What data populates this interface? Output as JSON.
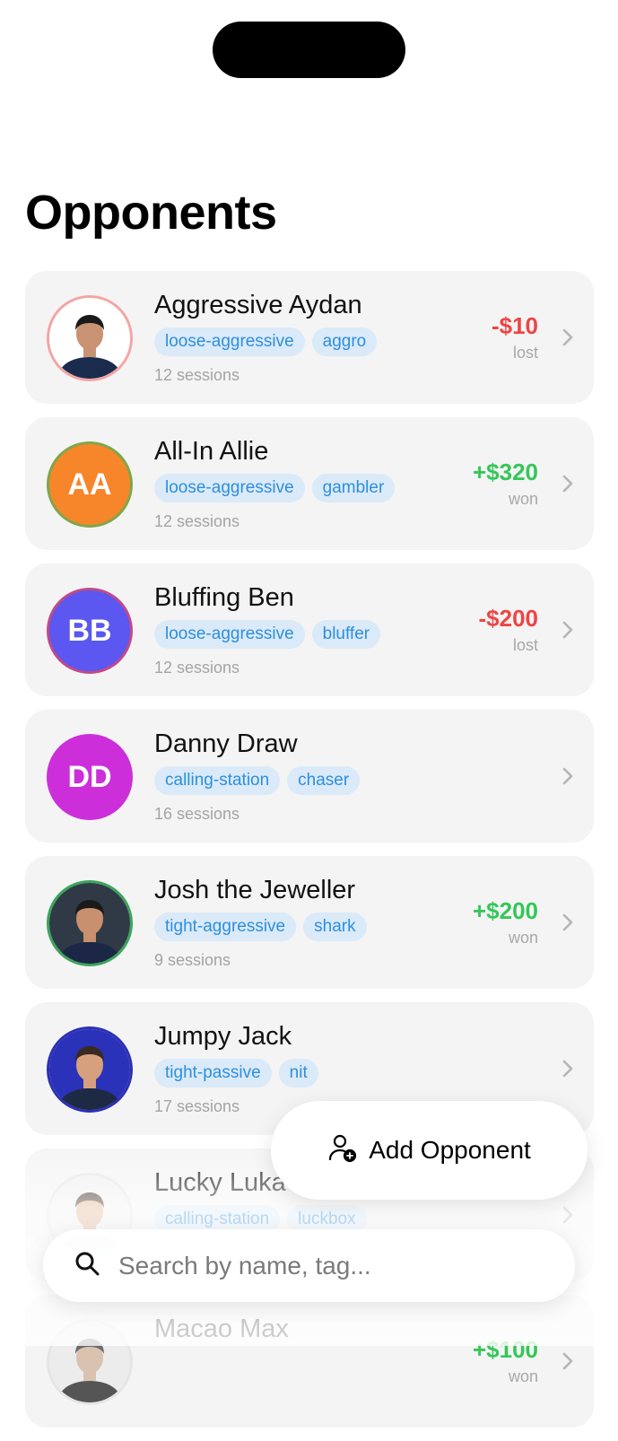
{
  "header": {
    "title": "Opponents"
  },
  "opponents": [
    {
      "name": "Aggressive Aydan",
      "initials": "",
      "tags": [
        "loose-aggressive",
        "aggro"
      ],
      "sessions": "12 sessions",
      "amount": "-$10",
      "result": "lost",
      "ring": "#f4a4a4"
    },
    {
      "name": "All-In Allie",
      "initials": "AA",
      "tags": [
        "loose-aggressive",
        "gambler"
      ],
      "sessions": "12 sessions",
      "amount": "+$320",
      "result": "won",
      "fill": "#f7862a",
      "ring": "#7fa64a"
    },
    {
      "name": "Bluffing Ben",
      "initials": "BB",
      "tags": [
        "loose-aggressive",
        "bluffer"
      ],
      "sessions": "12 sessions",
      "amount": "-$200",
      "result": "lost",
      "fill": "#5b57f0",
      "ring": "#c04a8a"
    },
    {
      "name": "Danny Draw",
      "initials": "DD",
      "tags": [
        "calling-station",
        "chaser"
      ],
      "sessions": "16 sessions",
      "amount": "",
      "result": "",
      "fill": "#cc2fd9",
      "ring": "#cc2fd9"
    },
    {
      "name": "Josh the Jeweller",
      "initials": "",
      "tags": [
        "tight-aggressive",
        "shark"
      ],
      "sessions": "9 sessions",
      "amount": "+$200",
      "result": "won",
      "ring": "#3aa55c"
    },
    {
      "name": "Jumpy Jack",
      "initials": "",
      "tags": [
        "tight-passive",
        "nit"
      ],
      "sessions": "17 sessions",
      "amount": "",
      "result": "",
      "ring": "#2c2fb5"
    },
    {
      "name": "Lucky Luka",
      "initials": "",
      "tags": [
        "calling-station",
        "luckbox"
      ],
      "sessions": "",
      "amount": "",
      "result": "",
      "ring": "#e5e5e5"
    },
    {
      "name": "Macao Max",
      "initials": "",
      "tags": [],
      "sessions": "",
      "amount": "+$100",
      "result": "won",
      "ring": "#e5e5e5"
    }
  ],
  "add_button": {
    "label": "Add Opponent",
    "icon": "add-person-icon"
  },
  "search": {
    "placeholder": "Search by name, tag...",
    "value": "",
    "icon": "search-icon"
  },
  "colors": {
    "won": "#34c759",
    "lost": "#ef4444",
    "tag_bg": "#dbeaf8",
    "tag_text": "#2b8fe0"
  }
}
